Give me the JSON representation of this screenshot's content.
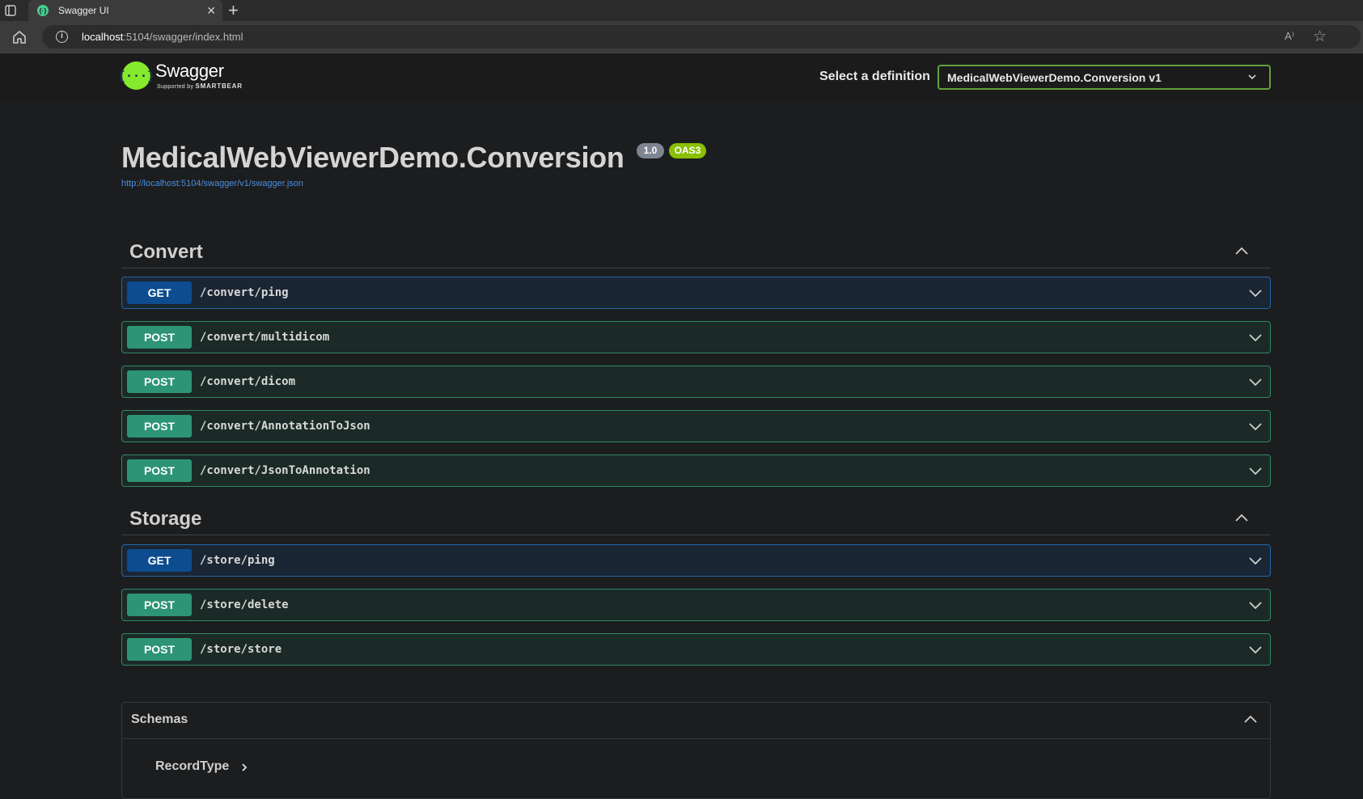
{
  "browser": {
    "tab_title": "Swagger UI",
    "favicon": "{·}",
    "close_glyph": "✕",
    "new_tab_glyph": "+",
    "url_host": "localhost",
    "url_rest": ":5104/swagger/index.html",
    "read_aloud_glyph": "A⁾",
    "favorite_glyph": "☆",
    "info_glyph": "i"
  },
  "topbar": {
    "logo_mark": "{···}",
    "logo_name": "Swagger",
    "logo_sub_prefix": "Supported by",
    "logo_sub_brand": "SMARTBEAR",
    "definition_label": "Select a definition",
    "definition_value": "MedicalWebViewerDemo.Conversion v1"
  },
  "info": {
    "title": "MedicalWebViewerDemo.Conversion",
    "version": "1.0",
    "oas": "OAS3",
    "spec_url": "http://localhost:5104/swagger/v1/swagger.json"
  },
  "sections": [
    {
      "title": "Convert",
      "operations": [
        {
          "method": "GET",
          "path": "/convert/ping"
        },
        {
          "method": "POST",
          "path": "/convert/multidicom"
        },
        {
          "method": "POST",
          "path": "/convert/dicom"
        },
        {
          "method": "POST",
          "path": "/convert/AnnotationToJson"
        },
        {
          "method": "POST",
          "path": "/convert/JsonToAnnotation"
        }
      ]
    },
    {
      "title": "Storage",
      "operations": [
        {
          "method": "GET",
          "path": "/store/ping"
        },
        {
          "method": "POST",
          "path": "/store/delete"
        },
        {
          "method": "POST",
          "path": "/store/store"
        }
      ]
    }
  ],
  "schemas": {
    "title": "Schemas",
    "models": [
      "RecordType"
    ]
  },
  "colors": {
    "get": "#0d4c8f",
    "post": "#2d9474",
    "link": "#4990e2",
    "logo": "#85ea2d"
  }
}
